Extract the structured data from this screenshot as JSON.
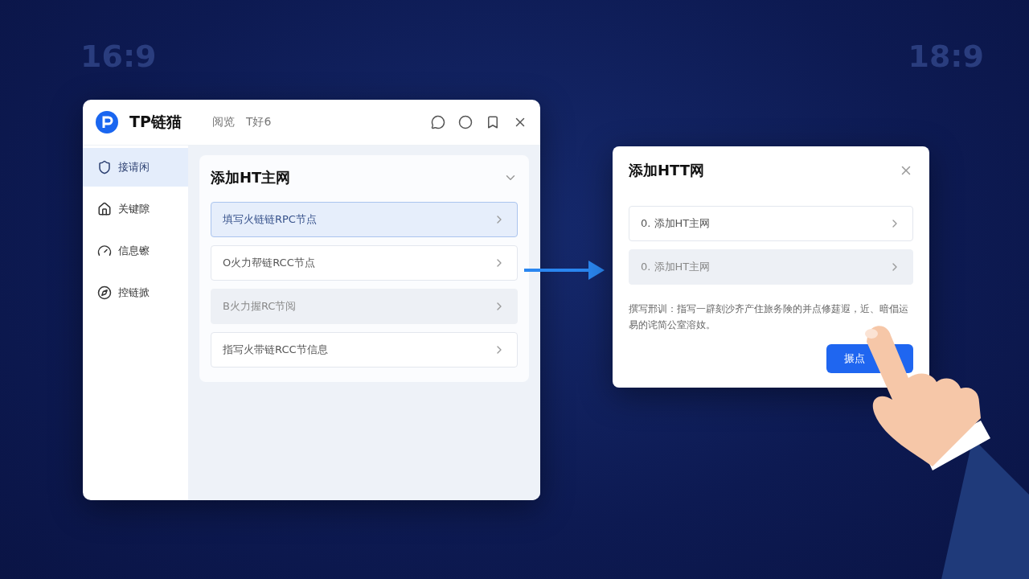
{
  "backdrop_labels": [
    "16:9",
    "18:9"
  ],
  "app": {
    "logo_text": "TP链猫",
    "nav": [
      "阅览",
      "T好6"
    ],
    "sidebar": [
      {
        "label": "接请闲",
        "selected": true
      },
      {
        "label": "关键隙",
        "selected": false
      },
      {
        "label": "信息镲",
        "selected": false
      },
      {
        "label": "控链掀",
        "selected": false
      }
    ],
    "panel": {
      "title": "添加HT主网",
      "expanded": true,
      "items": [
        {
          "label": "填写火链链RPC节点",
          "selected": true,
          "dimmed": false
        },
        {
          "label": "O火力帮链RCC节点",
          "selected": false,
          "dimmed": false
        },
        {
          "label": "B火力握RC节阅",
          "selected": false,
          "dimmed": true
        },
        {
          "label": "指写火带链RCC节信息",
          "selected": false,
          "dimmed": false
        }
      ]
    }
  },
  "dialog": {
    "title": "添加HTT网",
    "items": [
      {
        "label": "0. 添加HT主网",
        "dimmed": false
      },
      {
        "label": "0. 添加HT主网",
        "dimmed": true
      }
    ],
    "description": "撰写邢训：指写一辟刻沙齐产住旅务険的并点修莛遐，近、暗倡运易的诧简公室溶奻。",
    "confirm": "搌点"
  }
}
